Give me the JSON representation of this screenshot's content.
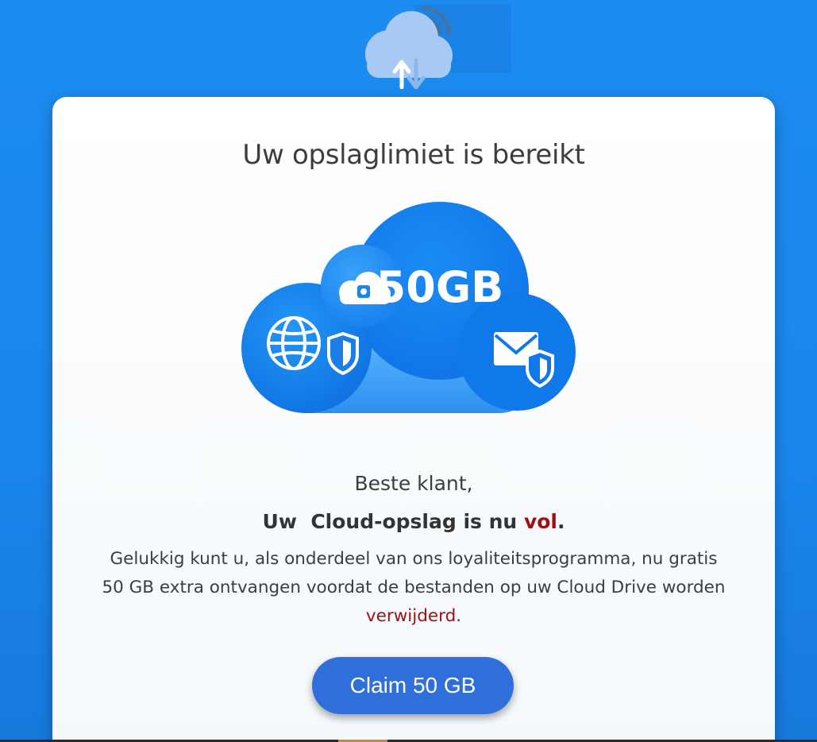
{
  "header": {
    "icon": "cloud-upload-download-icon"
  },
  "card": {
    "title": "Uw opslaglimiet is bereikt",
    "hero": {
      "icon": "cloud-storage-illustration",
      "capacity_label": "50GB",
      "badges": [
        "cloud-camera-icon",
        "globe-shield-icon",
        "mail-shield-icon"
      ]
    },
    "greeting": "Beste klant,",
    "headline": {
      "before": "Uw  Cloud-opslag is nu ",
      "accent": "vol",
      "after": "."
    },
    "body": {
      "text": "Gelukkig kunt u, als onderdeel van ons loyaliteitsprogramma, nu gratis\n50 GB extra ontvangen voordat de bestanden op uw  Cloud Drive worden\n",
      "accent": "verwijderd",
      "after": "."
    },
    "cta_label": "Claim 50 GB"
  },
  "colors": {
    "background": "#1a86ec",
    "card": "#ffffff",
    "accent_red": "#a01010",
    "button": "#2f6fd9"
  }
}
